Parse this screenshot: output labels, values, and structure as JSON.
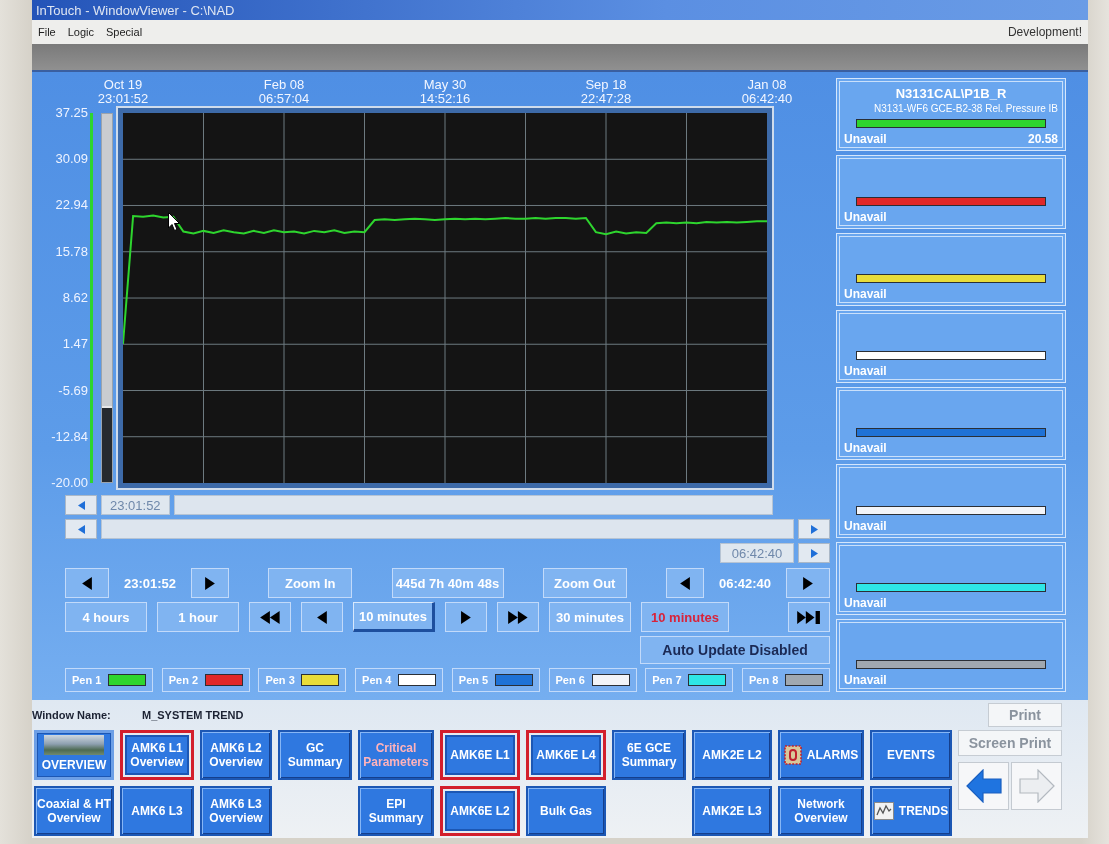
{
  "window": {
    "title": "InTouch - WindowViewer - C:\\NAD"
  },
  "menu": {
    "items": [
      "File",
      "Logic",
      "Special"
    ],
    "mode": "Development!"
  },
  "trend": {
    "chart_data": {
      "type": "line",
      "grid": true,
      "categories": [
        "Oct 19 23:01:52",
        null,
        null,
        null,
        null,
        null,
        null,
        null,
        null,
        null,
        null,
        null,
        null,
        null,
        null,
        null,
        "Feb 08 06:57:04",
        null,
        null,
        null,
        null,
        null,
        null,
        null,
        null,
        null,
        null,
        null,
        null,
        null,
        null,
        null,
        "May 30 14:52:16",
        null,
        null,
        null,
        null,
        null,
        null,
        null,
        null,
        null,
        null,
        null,
        null,
        null,
        null,
        null,
        "Sep 18 22:47:28",
        null,
        null,
        null,
        null,
        null,
        null,
        null,
        null,
        null,
        null,
        null,
        null,
        null,
        null,
        null,
        "Jan 08 06:42:40"
      ],
      "series": [
        {
          "color": "#2ed52e",
          "values": [
            1.5,
            21.3,
            21.2,
            21.4,
            21.1,
            21.2,
            18.9,
            18.6,
            19.0,
            18.7,
            19.1,
            18.8,
            18.6,
            19.0,
            18.7,
            19.1,
            18.8,
            18.9,
            18.6,
            19.0,
            18.8,
            19.1,
            18.7,
            18.9,
            18.8,
            20.7,
            20.8,
            20.7,
            20.8,
            20.9,
            20.8,
            20.7,
            20.8,
            20.9,
            20.8,
            20.9,
            20.8,
            20.9,
            21.0,
            20.9,
            20.9,
            21.0,
            20.9,
            21.0,
            21.0,
            20.9,
            21.0,
            18.8,
            18.5,
            18.9,
            18.6,
            18.8,
            18.7,
            20.2,
            20.3,
            20.2,
            20.3,
            20.2,
            20.4,
            20.3,
            20.4,
            20.3,
            20.4,
            20.5,
            20.5
          ]
        }
      ],
      "ylim": [
        -20,
        37.25
      ],
      "yticks": [
        37.25,
        30.09,
        22.94,
        15.78,
        8.62,
        1.47,
        -5.69,
        -12.84,
        {
          "value": -20,
          "label": "-20.00"
        }
      ]
    },
    "scroll_start": "23:01:52",
    "scroll_end": "06:42:40",
    "start_time": "23:01:52",
    "zoom_in": "Zoom In",
    "span": "445d 7h 40m 48s",
    "zoom_out": "Zoom Out",
    "end_time": "06:42:40",
    "steps": [
      {
        "kind": "text",
        "label": "4 hours",
        "selected": false
      },
      {
        "kind": "text",
        "label": "1 hour",
        "selected": false
      },
      {
        "kind": "rewind",
        "selected": false
      },
      {
        "kind": "back",
        "selected": false
      },
      {
        "kind": "text",
        "label": "10 minutes",
        "selected": true
      },
      {
        "kind": "forward",
        "selected": false
      },
      {
        "kind": "fast-forward",
        "selected": false
      },
      {
        "kind": "text",
        "label": "30 minutes",
        "selected": false
      },
      {
        "kind": "readout",
        "label": "10 minutes",
        "selected": false
      },
      {
        "kind": "end",
        "selected": false
      }
    ],
    "auto_update": "Auto Update Disabled",
    "pens": [
      {
        "label": "Pen 1",
        "color": "#2ed52e"
      },
      {
        "label": "Pen 2",
        "color": "#e02828"
      },
      {
        "label": "Pen 3",
        "color": "#e8dc3a"
      },
      {
        "label": "Pen 4",
        "color": "#ffffff"
      },
      {
        "label": "Pen 5",
        "color": "#1f72d6"
      },
      {
        "label": "Pen 6",
        "color": "#f2f4f8"
      },
      {
        "label": "Pen 7",
        "color": "#2ee6e6"
      },
      {
        "label": "Pen 8",
        "color": "#a0a8b0"
      }
    ]
  },
  "legend": [
    {
      "tag": "N3131CAL\\P1B_R",
      "description": "N3131-WF6 GCE-B2-38 Rel. Pressure IB",
      "status": "Unavail",
      "value": "20.58"
    },
    {
      "status": "Unavail"
    },
    {
      "status": "Unavail"
    },
    {
      "status": "Unavail"
    },
    {
      "status": "Unavail"
    },
    {
      "status": "Unavail"
    },
    {
      "status": "Unavail"
    },
    {
      "status": "Unavail"
    }
  ],
  "window_name": {
    "label": "Window Name:",
    "value": "M_SYSTEM TREND"
  },
  "print_button": {
    "label": "Print",
    "disabled": true
  },
  "nav_columns": [
    [
      {
        "kind": "photo",
        "lines": [
          "OVERVIEW"
        ],
        "outlined": false,
        "alert_text": false
      },
      {
        "kind": "plain",
        "lines": [
          "Coaxial & HT",
          "Overview"
        ],
        "outlined": false,
        "alert_text": false
      }
    ],
    [
      {
        "kind": "plain",
        "lines": [
          "AMK6 L1",
          "Overview"
        ],
        "outlined": true,
        "alert_text": false
      },
      {
        "kind": "plain",
        "lines": [
          "AMK6 L3"
        ],
        "outlined": false,
        "alert_text": false
      }
    ],
    [
      {
        "kind": "plain",
        "lines": [
          "AMK6 L2",
          "Overview"
        ],
        "outlined": false,
        "alert_text": false
      },
      {
        "kind": "plain",
        "lines": [
          "AMK6 L3",
          "Overview"
        ],
        "outlined": false,
        "alert_text": false
      }
    ],
    [
      {
        "kind": "plain",
        "lines": [
          "GC",
          "Summary"
        ],
        "outlined": false,
        "alert_text": false
      }
    ],
    [
      {
        "kind": "plain",
        "lines": [
          "Critical",
          "Parameters"
        ],
        "outlined": false,
        "alert_text": true
      },
      {
        "kind": "plain",
        "lines": [
          "EPI",
          "Summary"
        ],
        "outlined": false,
        "alert_text": false
      }
    ],
    [
      {
        "kind": "plain",
        "lines": [
          "AMK6E L1"
        ],
        "outlined": true,
        "alert_text": false
      },
      {
        "kind": "plain",
        "lines": [
          "AMK6E L2"
        ],
        "outlined": true,
        "alert_text": false
      }
    ],
    [
      {
        "kind": "plain",
        "lines": [
          "AMK6E L4"
        ],
        "outlined": true,
        "alert_text": false
      },
      {
        "kind": "plain",
        "lines": [
          "Bulk Gas"
        ],
        "outlined": false,
        "alert_text": false
      }
    ],
    [
      {
        "kind": "plain",
        "lines": [
          "6E GCE",
          "Summary"
        ],
        "outlined": false,
        "alert_text": false
      }
    ],
    [
      {
        "kind": "plain",
        "lines": [
          "AMK2E L2"
        ],
        "outlined": false,
        "alert_text": false
      },
      {
        "kind": "plain",
        "lines": [
          "AMK2E L3"
        ],
        "outlined": false,
        "alert_text": false
      }
    ],
    [
      {
        "kind": "alarm",
        "lines": [
          "ALARMS"
        ],
        "outlined": false,
        "alert_text": false
      },
      {
        "kind": "plain",
        "lines": [
          "Network",
          "Overview"
        ],
        "outlined": false,
        "alert_text": false
      }
    ],
    [
      {
        "kind": "plain",
        "lines": [
          "EVENTS"
        ],
        "outlined": false,
        "alert_text": false
      },
      {
        "kind": "trend",
        "lines": [
          "TRENDS"
        ],
        "outlined": false,
        "alert_text": false
      }
    ]
  ],
  "screen_print_button": {
    "label": "Screen Print",
    "disabled": true
  },
  "history_buttons": [
    {
      "kind": "back",
      "disabled": false
    },
    {
      "kind": "forward",
      "disabled": true
    }
  ]
}
